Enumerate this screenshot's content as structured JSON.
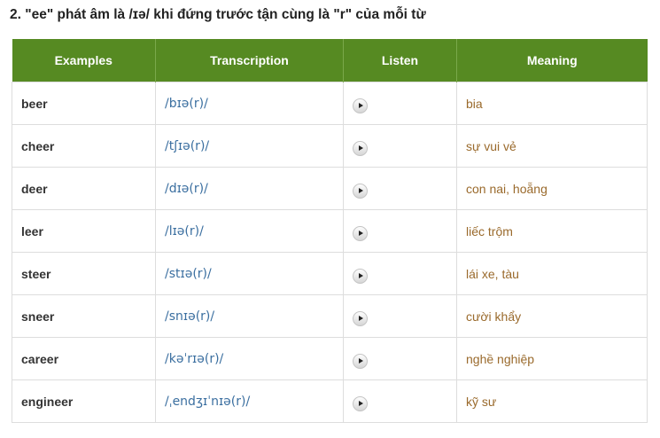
{
  "heading": "2. \"ee\" phát âm là /ɪə/ khi đứng trước tận cùng là \"r\" của mỗi từ",
  "table": {
    "headers": [
      "Examples",
      "Transcription",
      "Listen",
      "Meaning"
    ],
    "rows": [
      {
        "word": "beer",
        "ipa": "/bɪə(r)/",
        "meaning": "bia"
      },
      {
        "word": "cheer",
        "ipa": "/tʃɪə(r)/",
        "meaning": "sự vui vẻ"
      },
      {
        "word": "deer",
        "ipa": "/dɪə(r)/",
        "meaning": "con nai, hoẵng"
      },
      {
        "word": "leer",
        "ipa": "/lɪə(r)/",
        "meaning": "liếc trộm"
      },
      {
        "word": "steer",
        "ipa": "/stɪə(r)/",
        "meaning": "lái xe, tàu"
      },
      {
        "word": "sneer",
        "ipa": "/snɪə(r)/",
        "meaning": "cười khẩy"
      },
      {
        "word": "career",
        "ipa": "/kəˈrɪə(r)/",
        "meaning": "nghề nghiệp"
      },
      {
        "word": "engineer",
        "ipa": "/ˌendʒɪˈnɪə(r)/",
        "meaning": "kỹ sư"
      }
    ]
  },
  "icons": {
    "listen": "play-icon"
  },
  "colors": {
    "header_bg": "#568a22",
    "header_text": "#ffffff",
    "ipa_text": "#3b6fa0",
    "meaning_text": "#9a6a2c",
    "border": "#dddddd"
  }
}
